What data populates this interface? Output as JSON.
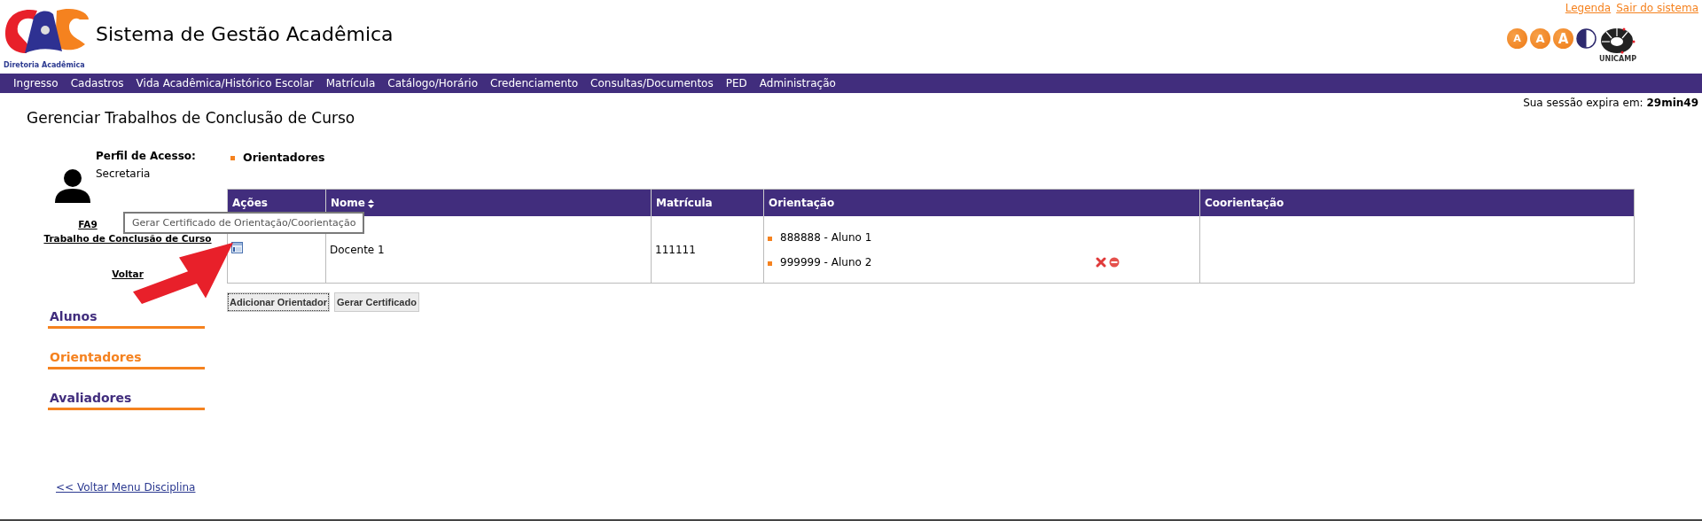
{
  "header": {
    "logo_caption": "Diretoria Acadêmica",
    "title": "Sistema de Gestão Acadêmica",
    "links": [
      "Legenda",
      "Sair do sistema"
    ],
    "font_buttons": [
      "A",
      "A",
      "A"
    ],
    "unicamp_caption": "UNICAMP"
  },
  "nav": [
    "Ingresso",
    "Cadastros",
    "Vida Acadêmica/Histórico Escolar",
    "Matrícula",
    "Catálogo/Horário",
    "Credenciamento",
    "Consultas/Documentos",
    "PED",
    "Administração"
  ],
  "page_title": "Gerenciar Trabalhos de Conclusão de Curso",
  "session": {
    "label": "Sua sessão expira em:",
    "value": "29min49"
  },
  "profile": {
    "label": "Perfil de Acesso:",
    "value": "Secretaria"
  },
  "discipline_links": [
    "FA9",
    "Trabalho de Conclusão de Curso",
    "Voltar"
  ],
  "sidebar_tabs": [
    {
      "label": "Alunos",
      "selected": false
    },
    {
      "label": "Orientadores",
      "selected": true
    },
    {
      "label": "Avaliadores",
      "selected": false
    }
  ],
  "back_link": "<< Voltar Menu Disciplina",
  "section_title": "Orientadores",
  "table": {
    "columns": [
      "Ações",
      "Nome",
      "Matrícula",
      "Orientação",
      "Coorientação"
    ],
    "rows": [
      {
        "name": "Docente 1",
        "matricula": "111111",
        "orientacao": [
          {
            "text": "888888 - Aluno 1",
            "actions": false
          },
          {
            "text": "999999 - Aluno 2",
            "actions": true
          }
        ]
      }
    ]
  },
  "tooltip": "Gerar Certificado de Orientação/Coorientação",
  "buttons": [
    "Adicionar Orientador",
    "Gerar Certificado"
  ]
}
